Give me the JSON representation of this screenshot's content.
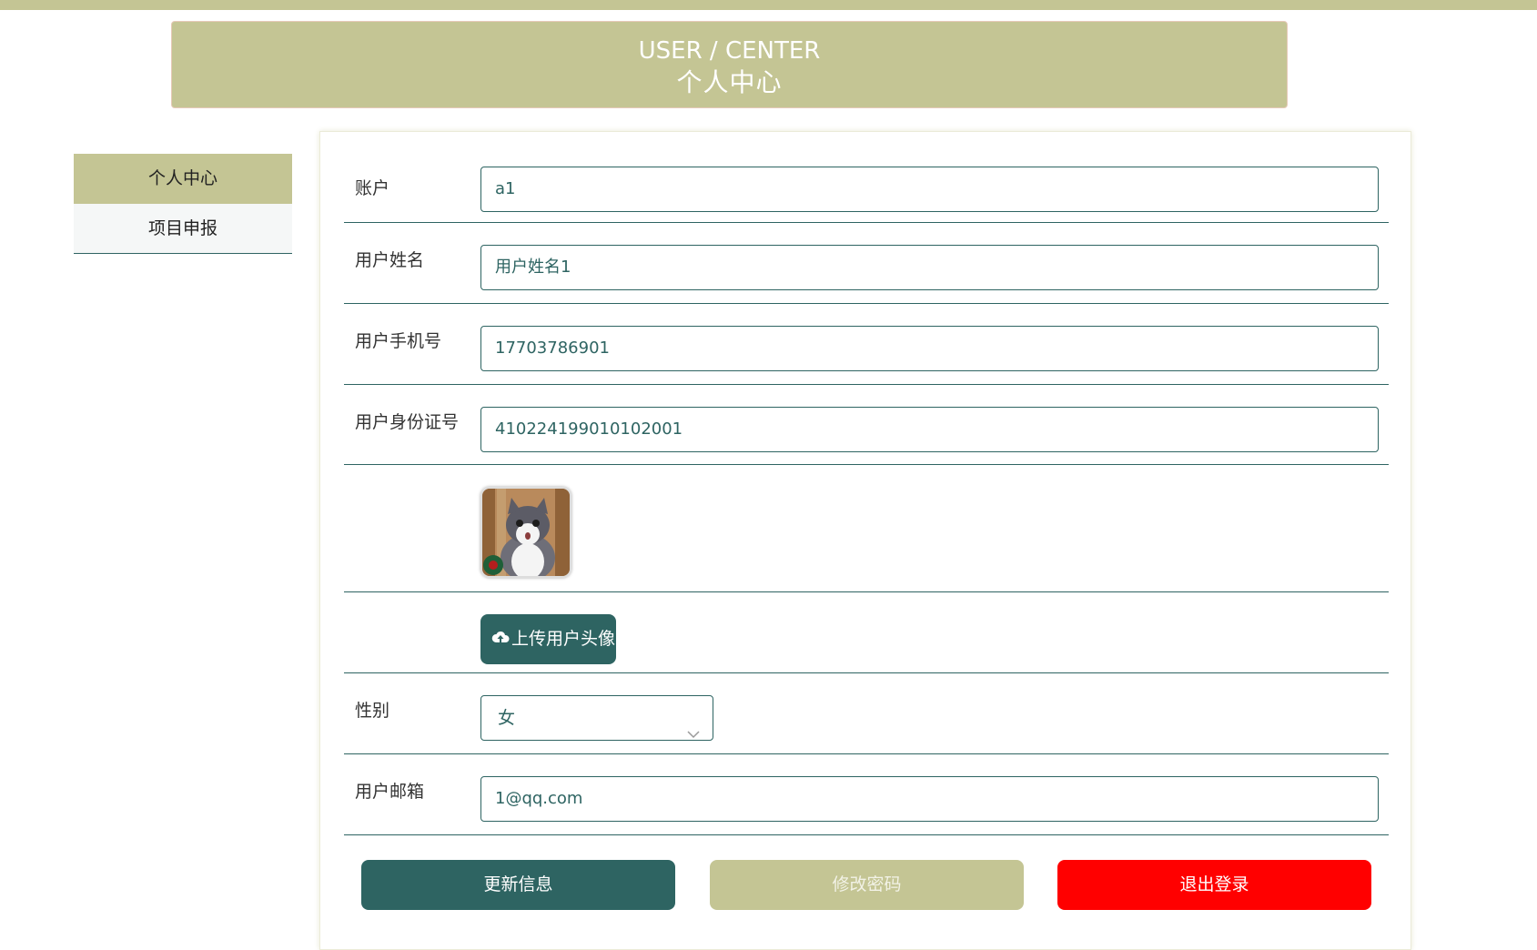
{
  "header": {
    "title_en": "USER / CENTER",
    "title_cn": "个人中心"
  },
  "sidebar": {
    "items": [
      {
        "label": "个人中心",
        "active": true
      },
      {
        "label": "项目申报",
        "active": false
      }
    ]
  },
  "form": {
    "account": {
      "label": "账户",
      "value": "a1"
    },
    "name": {
      "label": "用户姓名",
      "value": "用户姓名1"
    },
    "phone": {
      "label": "用户手机号",
      "value": "17703786901"
    },
    "id_card": {
      "label": "用户身份证号",
      "value": "410224199010102001"
    },
    "avatar": {
      "description": "cat-photo"
    },
    "upload_label": "上传用户头像",
    "gender": {
      "label": "性别",
      "value": "女"
    },
    "email": {
      "label": "用户邮箱",
      "value": "1@qq.com"
    }
  },
  "actions": {
    "update": "更新信息",
    "password": "修改密码",
    "logout": "退出登录"
  },
  "colors": {
    "accent": "#c4c594",
    "primary": "#2e6462",
    "danger": "#ff0000"
  }
}
